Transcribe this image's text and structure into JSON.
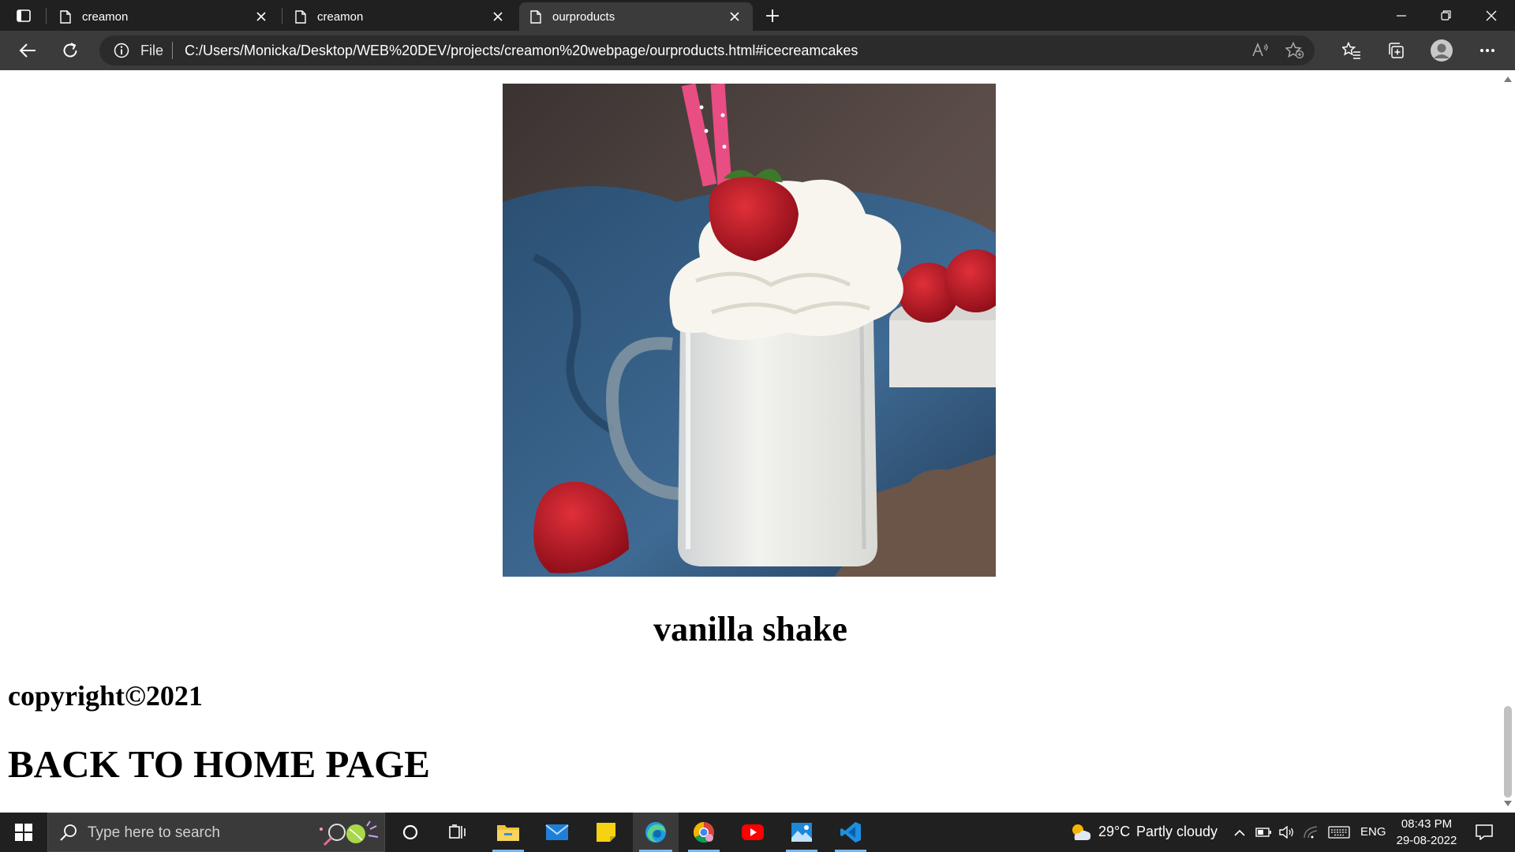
{
  "browser": {
    "tabs": [
      {
        "title": "creamon",
        "active": false
      },
      {
        "title": "creamon",
        "active": false
      },
      {
        "title": "ourproducts",
        "active": true
      }
    ],
    "address": {
      "scheme_label": "File",
      "url": "C:/Users/Monicka/Desktop/WEB%20DEV/projects/creamon%20webpage/ourproducts.html#icecreamcakes"
    }
  },
  "page": {
    "product": {
      "name": "vanilla shake",
      "image_alt": "vanilla shake with whipped cream and strawberry"
    },
    "footer": {
      "copyright": "copyright©2021",
      "home_link": "BACK TO HOME PAGE"
    }
  },
  "taskbar": {
    "search_placeholder": "Type here to search",
    "weather": {
      "temp": "29°C",
      "condition": "Partly cloudy"
    },
    "language": "ENG",
    "clock": {
      "time": "08:43 PM",
      "date": "29-08-2022"
    },
    "apps": [
      "cortana-icon",
      "task-view-icon",
      "file-explorer-icon",
      "mail-icon",
      "sticky-notes-icon",
      "edge-icon",
      "chrome-icon",
      "youtube-icon",
      "photos-icon",
      "vscode-icon"
    ]
  },
  "colors": {
    "tabstrip": "#202020",
    "toolbar": "#3b3b3b",
    "taskbar": "#202020",
    "page_bg": "#ffffff"
  }
}
